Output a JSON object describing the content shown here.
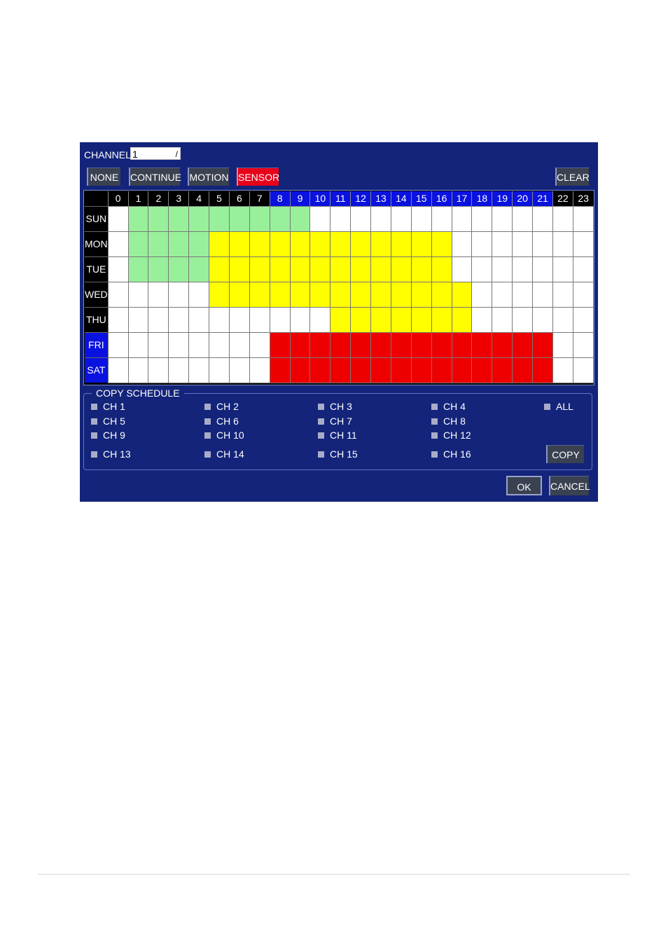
{
  "channel": {
    "label": "CHANNEL",
    "value": "1"
  },
  "mode_buttons": [
    {
      "label": "NONE",
      "active": false
    },
    {
      "label": "CONTINUE",
      "active": false
    },
    {
      "label": "MOTION",
      "active": false
    },
    {
      "label": "SENSOR",
      "active": true
    }
  ],
  "clear_label": "CLEAR",
  "schedule": {
    "hours": [
      "0",
      "1",
      "2",
      "3",
      "4",
      "5",
      "6",
      "7",
      "8",
      "9",
      "10",
      "11",
      "12",
      "13",
      "14",
      "15",
      "16",
      "17",
      "18",
      "19",
      "20",
      "21",
      "22",
      "23"
    ],
    "highlighted_hours": [
      8,
      9,
      10,
      11,
      12,
      13,
      14,
      15,
      16,
      17,
      18,
      19,
      20,
      21
    ],
    "legend": {
      "g": "CONTINUE",
      "y": "MOTION",
      "r": "SENSOR",
      "n": "NONE"
    },
    "colors": {
      "g": "#99f09b",
      "y": "#ffff00",
      "r": "#ee0000",
      "n": "#ffffff",
      "accent_blue": "#0a12e0",
      "panel_bg": "#13247a"
    },
    "days": [
      {
        "label": "SUN",
        "highlighted": false,
        "cells": "nggggggggg nnnnnnnnnnnnnn"
      },
      {
        "label": "MON",
        "highlighted": false,
        "cells": "nggggyyyyyyyyyyyynnnnnnn"
      },
      {
        "label": "TUE",
        "highlighted": false,
        "cells": "nggggyyyyyyyyyyyynnnnnnn"
      },
      {
        "label": "WED",
        "highlighted": false,
        "cells": "nnnnnyyyyyyyyyyyyynnnnnn"
      },
      {
        "label": "THU",
        "highlighted": false,
        "cells": "nnnnnnnnnnnyyyyyyynnnnnn"
      },
      {
        "label": "FRI",
        "highlighted": true,
        "cells": "nnnnnnnnrrrrrrrrrrrrrrnn"
      },
      {
        "label": "SAT",
        "highlighted": true,
        "cells": "nnnnnnnnrrrrrrrrrrrrrrnn"
      }
    ]
  },
  "copy_schedule": {
    "title": "COPY SCHEDULE",
    "channels": [
      "CH 1",
      "CH 2",
      "CH 3",
      "CH 4",
      "CH 5",
      "CH 6",
      "CH 7",
      "CH 8",
      "CH 9",
      "CH 10",
      "CH 11",
      "CH 12",
      "CH 13",
      "CH 14",
      "CH 15",
      "CH 16"
    ],
    "all_label": "ALL",
    "copy_label": "COPY"
  },
  "ok_label": "OK",
  "cancel_label": "CANCEL"
}
